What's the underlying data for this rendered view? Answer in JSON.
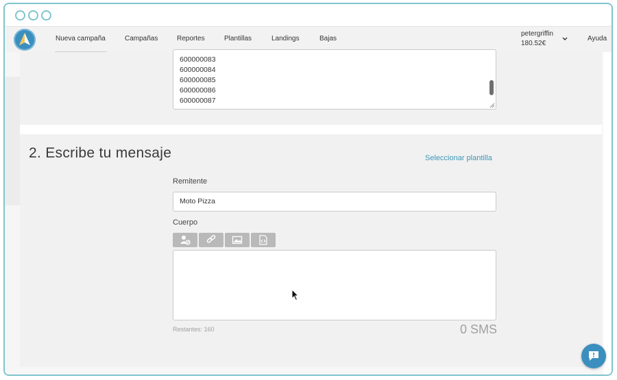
{
  "window": {
    "controls": [
      "circle",
      "circle",
      "circle"
    ]
  },
  "nav": {
    "items": [
      "Nueva campaña",
      "Campañas",
      "Reportes",
      "Plantillas",
      "Landings",
      "Bajas"
    ],
    "user_name": "petergriffin",
    "balance": "180.52€",
    "help": "Ayuda"
  },
  "recipients": {
    "numbers": [
      "600000083",
      "600000084",
      "600000085",
      "600000086",
      "600000087"
    ]
  },
  "message": {
    "heading": "2. Escribe tu mensaje",
    "template_link": "Seleccionar plantilla",
    "sender_label": "Remitente",
    "sender_value": "Moto Pizza",
    "body_label": "Cuerpo",
    "body_value": "",
    "toolbar_icons": [
      "user-tag-icon",
      "link-icon",
      "image-icon",
      "file-code-icon"
    ],
    "remaining": "Restantes: 160",
    "sms_count": "0 SMS"
  },
  "colors": {
    "accent": "#3b97b7",
    "frame": "#7fc4cd",
    "logo": "#3a8fbf"
  }
}
